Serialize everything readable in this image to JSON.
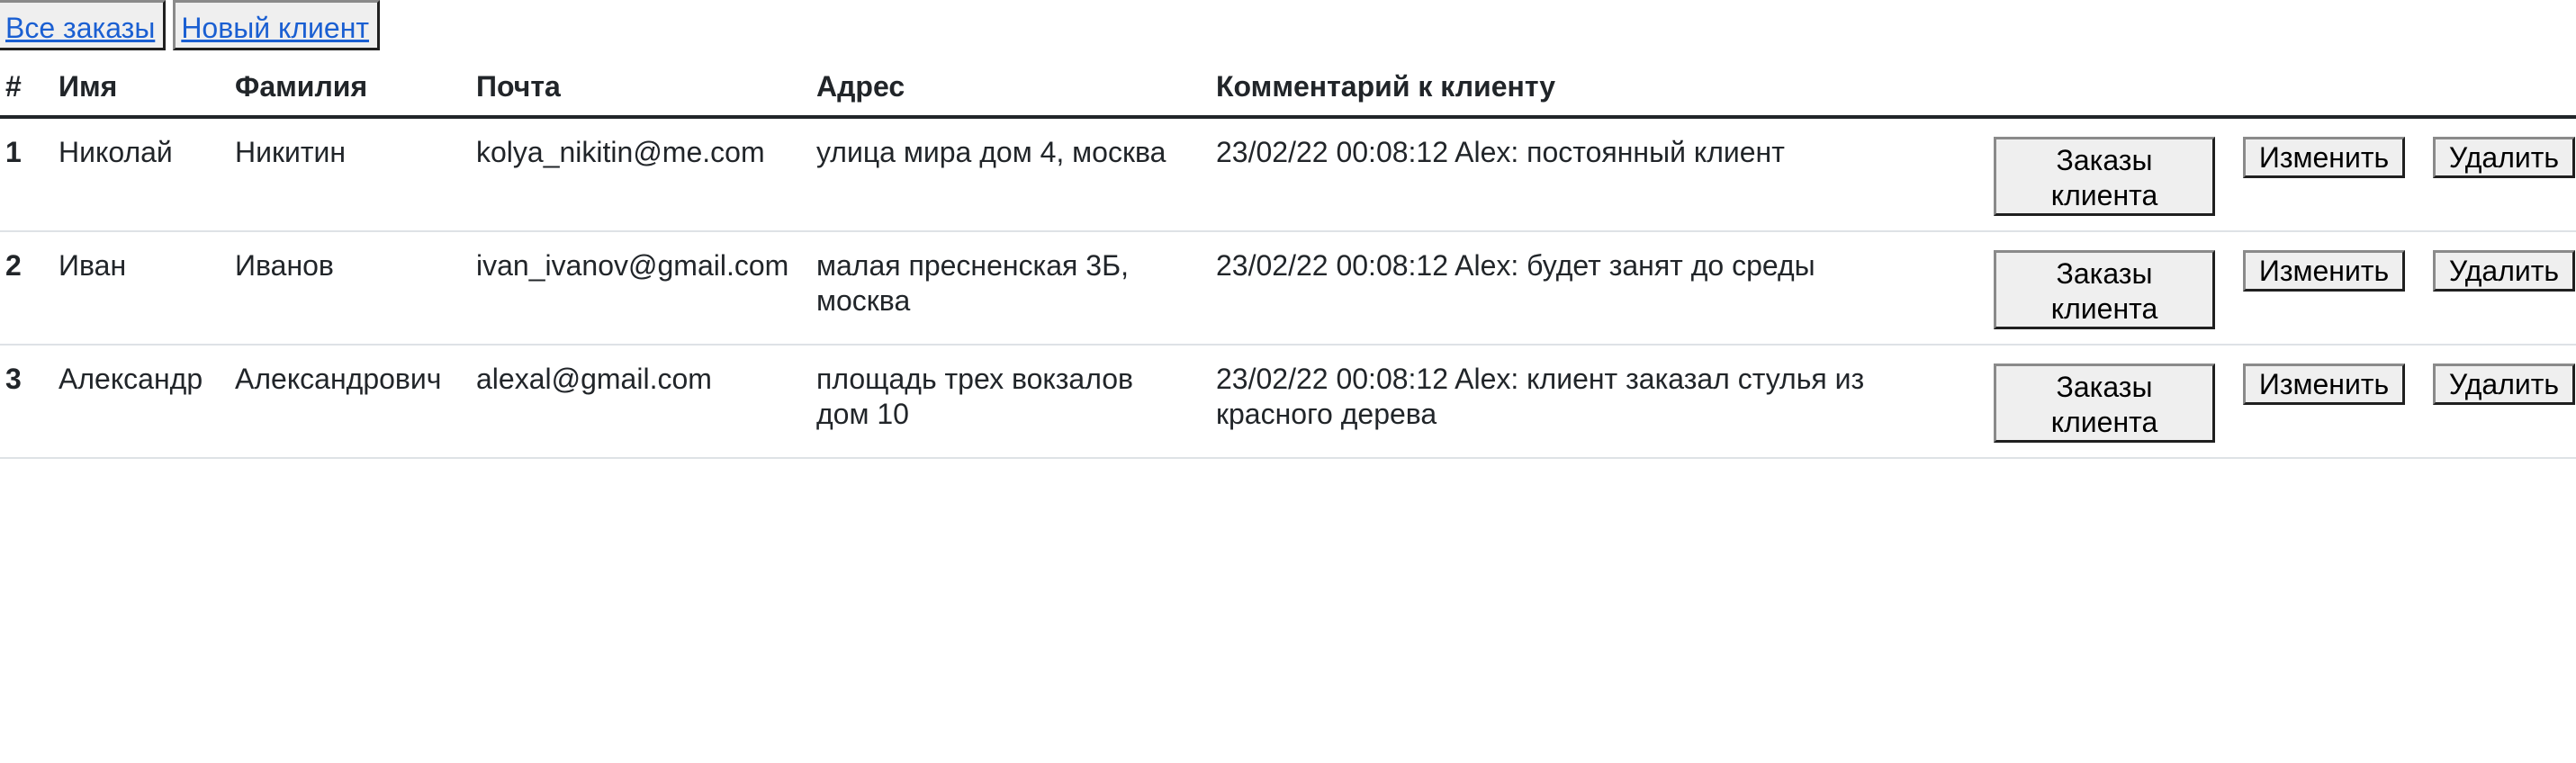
{
  "nav": {
    "all_orders": "Все заказы",
    "new_client": "Новый клиент"
  },
  "table": {
    "headers": {
      "num": "#",
      "first_name": "Имя",
      "last_name": "Фамилия",
      "email": "Почта",
      "address": "Адрес",
      "comment": "Комментарий к клиенту"
    },
    "rows": [
      {
        "num": "1",
        "first_name": "Николай",
        "last_name": "Никитин",
        "email": "kolya_nikitin@me.com",
        "address": "улица мира дом 4, москва",
        "comment": "23/02/22 00:08:12 Alex: постоянный клиент"
      },
      {
        "num": "2",
        "first_name": "Иван",
        "last_name": "Иванов",
        "email": "ivan_ivanov@gmail.com",
        "address": "малая пресненская 3Б, москва",
        "comment": "23/02/22 00:08:12 Alex: будет занят до среды"
      },
      {
        "num": "3",
        "first_name": "Александр",
        "last_name": "Александрович",
        "email": "alexal@gmail.com",
        "address": "площадь трех вокзалов дом 10",
        "comment": "23/02/22 00:08:12 Alex: клиент заказал стулья из красного дерева"
      }
    ],
    "actions": {
      "orders": "Заказы клиента",
      "edit": "Изменить",
      "delete": "Удалить"
    }
  }
}
